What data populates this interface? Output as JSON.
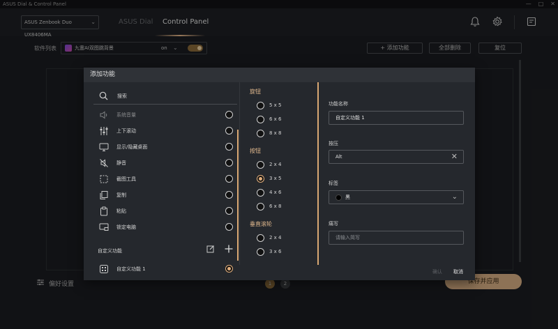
{
  "titlebar": {
    "title": "ASUS Dial & Control Panel",
    "controls": [
      "—",
      "□",
      "✕"
    ]
  },
  "header": {
    "device": "ASUS Zenbook Duo UX8406MA",
    "tabs": [
      {
        "label": "ASUS Dial",
        "active": false
      },
      {
        "label": "Control Panel",
        "active": true
      }
    ],
    "icons": [
      "bell-icon",
      "gear-icon",
      "feedback-icon"
    ]
  },
  "toolbar": {
    "software_label": "软件列表",
    "software_name": "九霊AI双图跳背景",
    "state": "on",
    "add_button": "+ 添加功能",
    "delete_all_button": "全部删除",
    "reset_button": "复位"
  },
  "bottom": {
    "preferences": "偏好设置",
    "pages": [
      "1",
      "2"
    ],
    "save_button": "保存并应用"
  },
  "dialog": {
    "title": "添加功能",
    "search_placeholder": "搜索",
    "functions": [
      {
        "label": "系统音量",
        "icon": "volume-icon",
        "selected": false,
        "faded": true
      },
      {
        "label": "上下滚动",
        "icon": "sliders-icon",
        "selected": false
      },
      {
        "label": "显示/隐藏桌面",
        "icon": "desktop-icon",
        "selected": false
      },
      {
        "label": "静音",
        "icon": "mute-icon",
        "selected": false
      },
      {
        "label": "截图工具",
        "icon": "screenshot-icon",
        "selected": false
      },
      {
        "label": "复制",
        "icon": "copy-icon",
        "selected": false
      },
      {
        "label": "粘贴",
        "icon": "paste-icon",
        "selected": false
      },
      {
        "label": "锁定电脑",
        "icon": "lock-computer-icon",
        "selected": false
      }
    ],
    "custom_section": "自定义功能",
    "custom_items": [
      {
        "label": "自定义功能 1",
        "icon": "custom-grid-icon",
        "selected": true
      }
    ],
    "layout_groups": [
      {
        "title": "旋钮",
        "options": [
          {
            "label": "5 x 5",
            "selected": false
          },
          {
            "label": "6 x 6",
            "selected": false
          },
          {
            "label": "8 x 8",
            "selected": false
          }
        ]
      },
      {
        "title": "按钮",
        "options": [
          {
            "label": "2 x 4",
            "selected": false
          },
          {
            "label": "3 x 5",
            "selected": true
          },
          {
            "label": "4 x 6",
            "selected": false
          },
          {
            "label": "6 x 8",
            "selected": false
          }
        ]
      },
      {
        "title": "垂直滚轮",
        "options": [
          {
            "label": "2 x 4",
            "selected": false
          },
          {
            "label": "3 x 6",
            "selected": false
          }
        ]
      }
    ],
    "form": {
      "name_label": "功能名称",
      "name_value": "自定义功能 1",
      "key_label": "按压",
      "key_value": "Alt",
      "tag_label": "标签",
      "tag_value": "黑",
      "note_label": "痛写",
      "note_placeholder": "请输入简写"
    },
    "ok_button": "确认",
    "cancel_button": "取消"
  },
  "colors": {
    "accent": "#e4b07d",
    "background": "#1b1d21",
    "dialog": "#25282d"
  }
}
